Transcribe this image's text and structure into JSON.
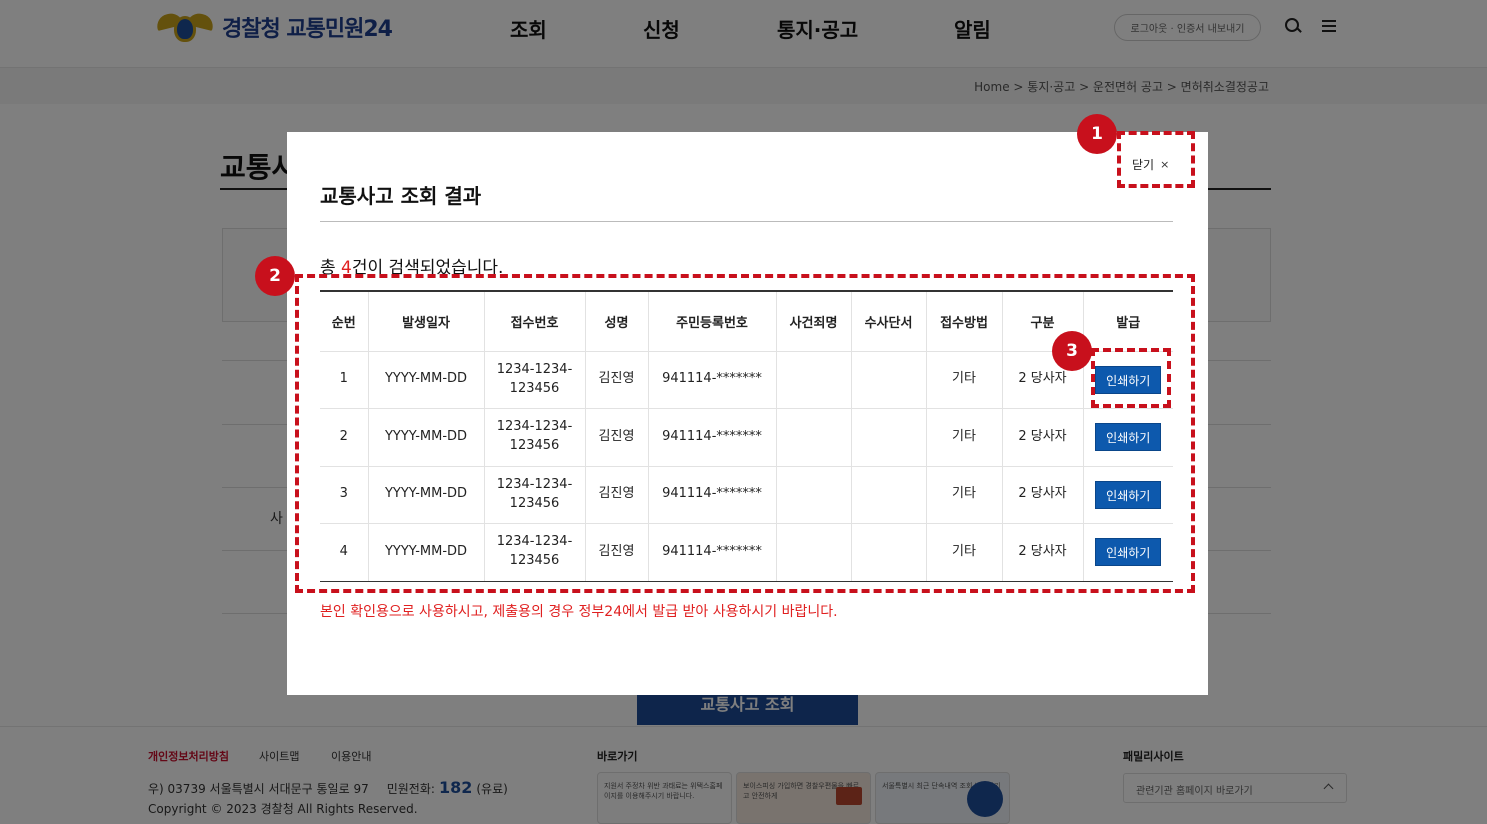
{
  "header": {
    "logo_text": "경찰청 교통민원24",
    "nav": [
      "조회",
      "신청",
      "통지·공고",
      "알림"
    ],
    "util_text": "로그아웃 · 인증서 내보내기"
  },
  "breadcrumb": "Home > 통지·공고 > 운전면허 공고 > 면허취소결정공고",
  "background": {
    "page_title": "교통사",
    "side_label": "사",
    "search_button": "교통사고 조회"
  },
  "footer": {
    "privacy": "개인정보처리방침",
    "sitemap": "사이트맵",
    "guide": "이용안내",
    "address": "우) 03739 서울특별시 서대문구 통일로 97",
    "phone_label": "민원전화:",
    "phone": "182",
    "phone_suffix": "(유료)",
    "copyright": "Copyright © 2023 경찰청  All Rights Reserved.",
    "shortcut_title": "바로가기",
    "family_title": "패밀리사이트",
    "family_select": "관련기관 홈페이지 바로가기",
    "banners": [
      "지원서 주정차 위반 과태료는 위택스홈페이지를 이용해주시기 바랍니다.",
      "보이스피싱 가입하면 경찰우편물을 빠르고 안전하게",
      "서울특별시 최근 단속내역 조회 바로가기"
    ]
  },
  "modal": {
    "title": "교통사고 조회 결과",
    "close_label": "닫기",
    "close_symbol": "×",
    "count_prefix": "총 ",
    "count": "4",
    "count_suffix": "건이 검색되었습니다.",
    "notice": "본인 확인용으로 사용하시고, 제출용의 경우 정부24에서 발급 받아 사용하시기 바랍니다."
  },
  "table": {
    "headers": [
      "순번",
      "발생일자",
      "접수번호",
      "성명",
      "주민등록번호",
      "사건죄명",
      "수사단서",
      "접수방법",
      "구분",
      "발급"
    ],
    "rows": [
      {
        "no": "1",
        "date": "YYYY-MM-DD",
        "receipt_1": "1234-1234-",
        "receipt_2": "123456",
        "name": "김진영",
        "rrn": "941114-*******",
        "charge": "",
        "clue": "",
        "method": "기타",
        "type": "2 당사자",
        "action": "인쇄하기"
      },
      {
        "no": "2",
        "date": "YYYY-MM-DD",
        "receipt_1": "1234-1234-",
        "receipt_2": "123456",
        "name": "김진영",
        "rrn": "941114-*******",
        "charge": "",
        "clue": "",
        "method": "기타",
        "type": "2 당사자",
        "action": "인쇄하기"
      },
      {
        "no": "3",
        "date": "YYYY-MM-DD",
        "receipt_1": "1234-1234-",
        "receipt_2": "123456",
        "name": "김진영",
        "rrn": "941114-*******",
        "charge": "",
        "clue": "",
        "method": "기타",
        "type": "2 당사자",
        "action": "인쇄하기"
      },
      {
        "no": "4",
        "date": "YYYY-MM-DD",
        "receipt_1": "1234-1234-",
        "receipt_2": "123456",
        "name": "김진영",
        "rrn": "941114-*******",
        "charge": "",
        "clue": "",
        "method": "기타",
        "type": "2 당사자",
        "action": "인쇄하기"
      }
    ]
  },
  "annotations": [
    "1",
    "2",
    "3"
  ],
  "colors": {
    "brand_blue": "#1f4f9b",
    "print_button": "#0d59ad",
    "highlight_red": "#e02020",
    "annotation_red": "#c8101c"
  }
}
